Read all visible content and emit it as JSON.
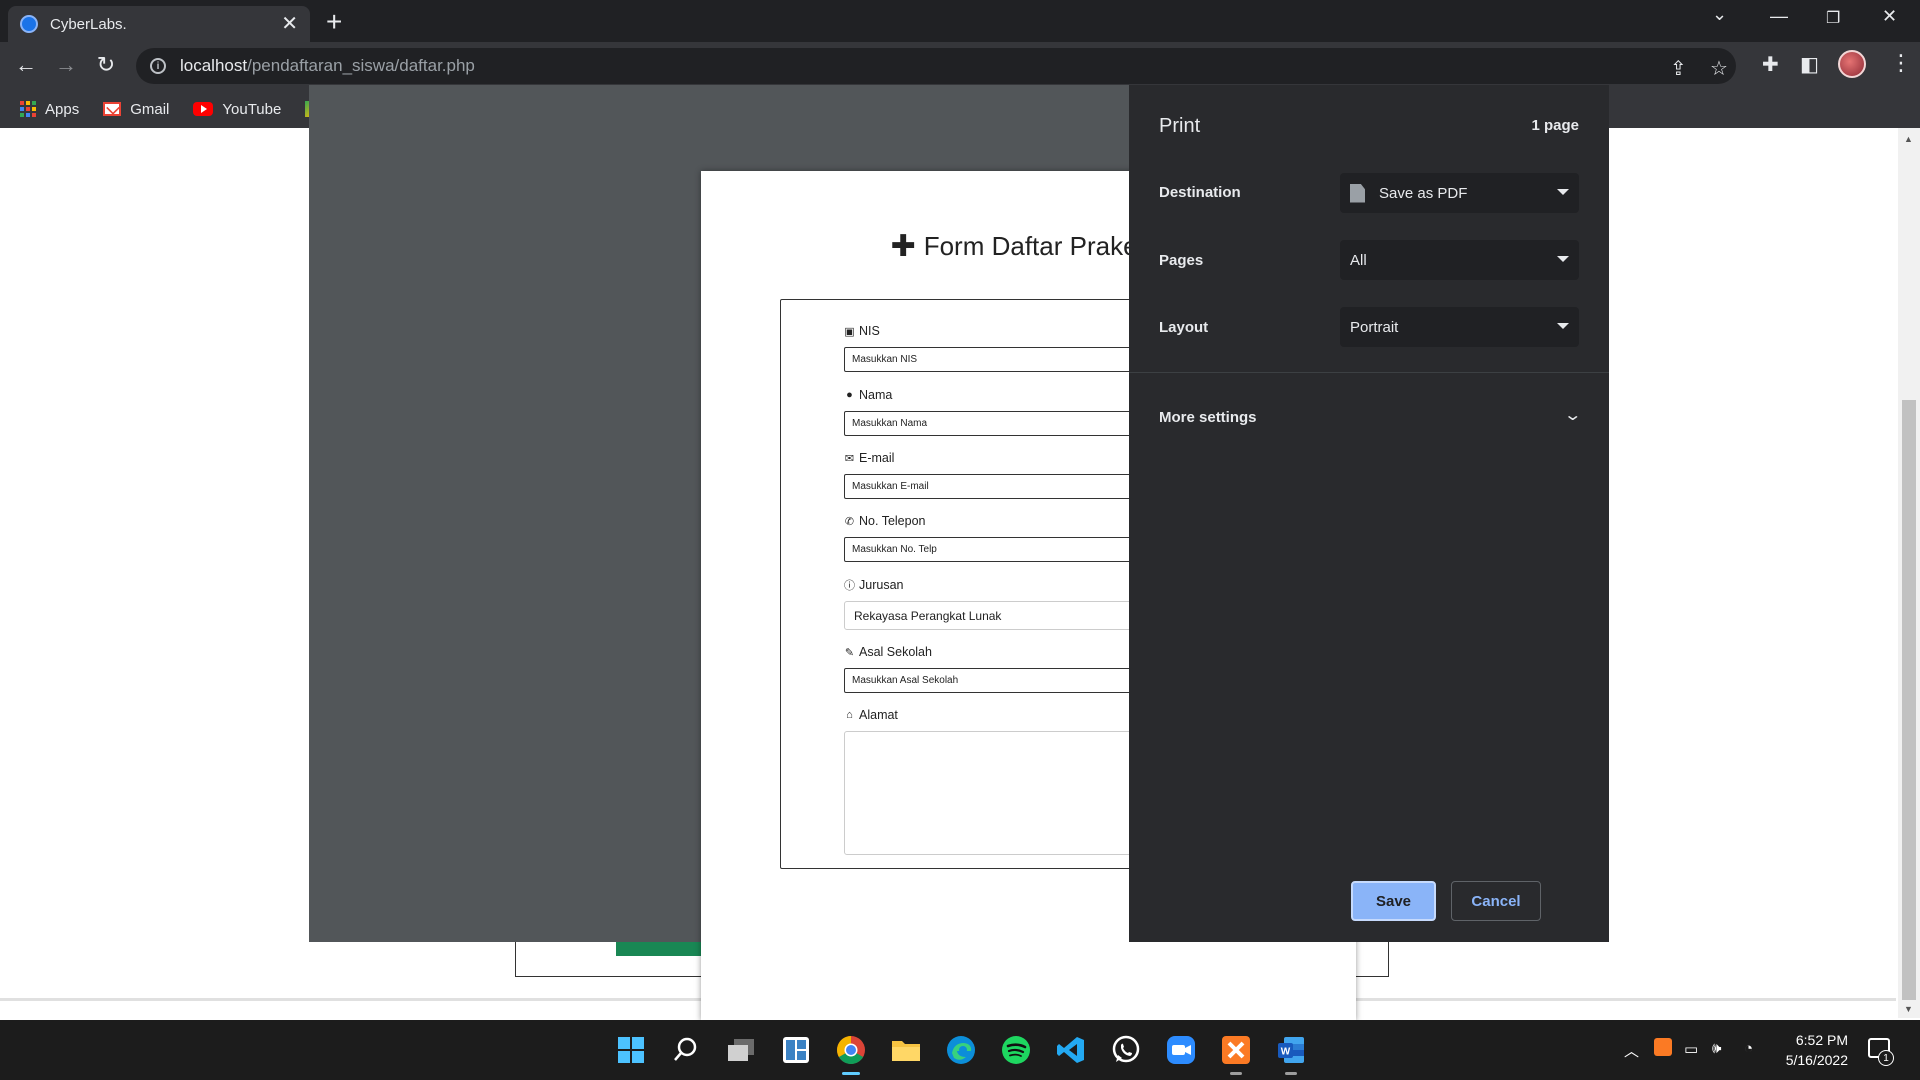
{
  "browser": {
    "tab_title": "CyberLabs.",
    "url_host": "localhost",
    "url_path": "/pendaftaran_siswa/daftar.php",
    "bookmarks": [
      {
        "label": "Apps"
      },
      {
        "label": "Gmail"
      },
      {
        "label": "YouTube"
      }
    ]
  },
  "form": {
    "title": "Form Daftar Prakerin",
    "fields": [
      {
        "label": "NIS",
        "icon": "id-card-icon",
        "placeholder": "Masukkan NIS",
        "kind": "input"
      },
      {
        "label": "Nama",
        "icon": "user-icon",
        "placeholder": "Masukkan Nama",
        "kind": "input"
      },
      {
        "label": "E-mail",
        "icon": "envelope-icon",
        "placeholder": "Masukkan E-mail",
        "kind": "input"
      },
      {
        "label": "No. Telepon",
        "icon": "phone-icon",
        "placeholder": "Masukkan No. Telp",
        "kind": "input"
      },
      {
        "label": "Jurusan",
        "icon": "info-circle-icon",
        "value": "Rekayasa Perangkat Lunak",
        "kind": "select"
      },
      {
        "label": "Asal Sekolah",
        "icon": "edit-icon",
        "placeholder": "Masukkan Asal Sekolah",
        "kind": "input"
      },
      {
        "label": "Alamat",
        "icon": "home-icon",
        "placeholder": "",
        "kind": "textarea"
      }
    ]
  },
  "print": {
    "title": "Print",
    "page_count": "1 page",
    "destination_label": "Destination",
    "destination_value": "Save as PDF",
    "pages_label": "Pages",
    "pages_value": "All",
    "layout_label": "Layout",
    "layout_value": "Portrait",
    "more_settings": "More settings",
    "save_label": "Save",
    "cancel_label": "Cancel"
  },
  "taskbar": {
    "apps": [
      "windows-start",
      "search",
      "task-view",
      "widgets",
      "chrome",
      "file-explorer",
      "edge",
      "spotify",
      "vscode",
      "whatsapp",
      "zoom",
      "xampp",
      "word"
    ],
    "time": "6:52 PM",
    "date": "5/16/2022",
    "notifications": "1"
  },
  "colors": {
    "chrome_dark": "#202124",
    "chrome_toolbar": "#35363a",
    "print_panel": "#292a2d",
    "accent_blue": "#8ab4f8",
    "preview_bg": "#525659",
    "page_button_green": "#198754"
  }
}
